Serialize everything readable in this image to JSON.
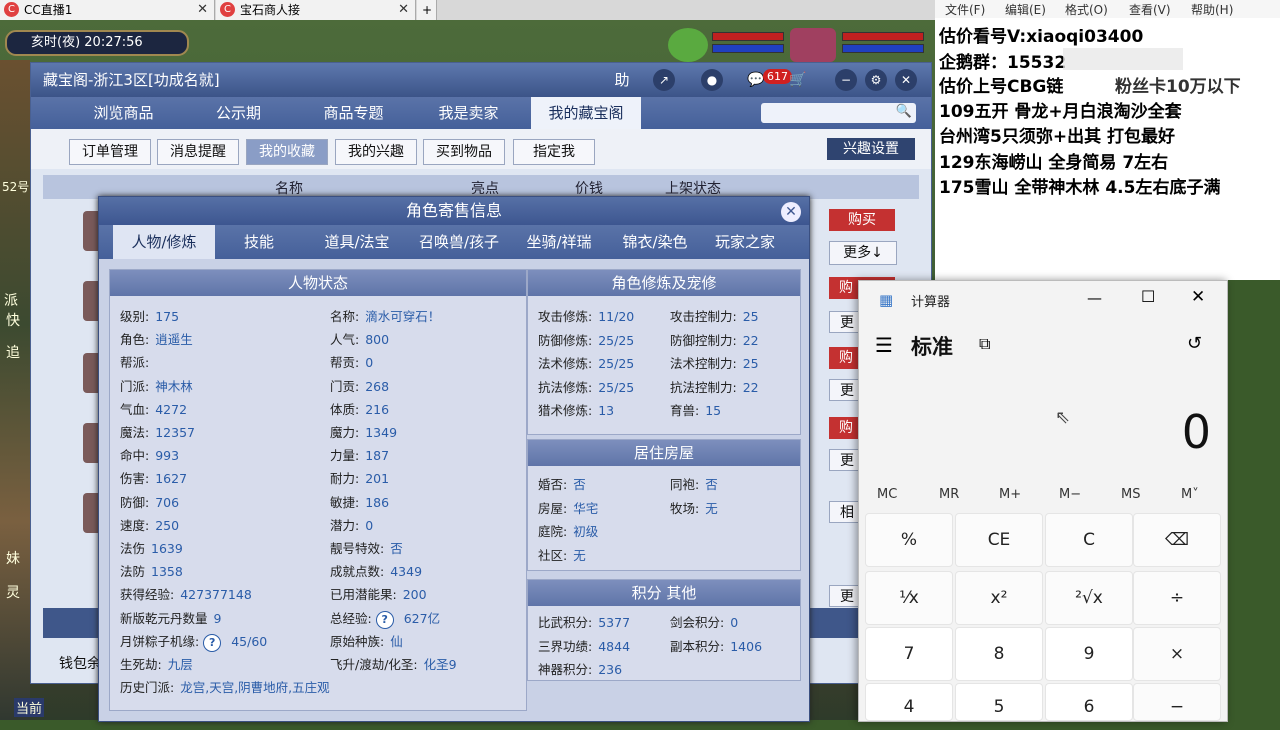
{
  "browser": {
    "tabs": [
      {
        "label": "CC直播1"
      },
      {
        "label": "宝石商人接"
      }
    ],
    "add_tab": "+"
  },
  "game": {
    "time": "亥时(夜)  20:27:56",
    "left_edge_text": [
      "52号",
      "派",
      "快",
      "追",
      "妹",
      "灵",
      "当前"
    ]
  },
  "cbg": {
    "title": "藏宝阁-浙江3区[功成名就]",
    "title_buttons": {
      "help": "助",
      "msg_count": "617"
    },
    "nav": [
      "浏览商品",
      "公示期",
      "商品专题",
      "我是卖家",
      "我的藏宝阁"
    ],
    "subnav": [
      "订单管理",
      "消息提醒",
      "我的收藏",
      "我的兴趣",
      "买到物品",
      "指定我"
    ],
    "interest_button": "兴趣设置",
    "list_header": [
      "名称",
      "亮点",
      "价钱",
      "上架状态"
    ],
    "row_buttons": {
      "buy": "购买",
      "more": "更多↓",
      "buy_partial": "购",
      "more_partial": "更",
      "rel_partial": "相"
    },
    "wallet_label": "钱包余"
  },
  "dialog": {
    "title": "角色寄售信息",
    "tabs": [
      "人物/修炼",
      "技能",
      "道具/法宝",
      "召唤兽/孩子",
      "坐骑/祥瑞",
      "锦衣/染色",
      "玩家之家"
    ],
    "status": {
      "header": "人物状态",
      "left": [
        [
          "级别:",
          "175"
        ],
        [
          "角色:",
          "逍遥生"
        ],
        [
          "帮派:",
          ""
        ],
        [
          "门派:",
          "神木林"
        ],
        [
          "气血:",
          "4272"
        ],
        [
          "魔法:",
          "12357"
        ],
        [
          "命中:",
          "993"
        ],
        [
          "伤害:",
          "1627"
        ],
        [
          "防御:",
          "706"
        ],
        [
          "速度:",
          "250"
        ],
        [
          "法伤",
          "1639"
        ],
        [
          "法防",
          "1358"
        ],
        [
          "获得经验:",
          "427377148"
        ],
        [
          "新版乾元丹数量",
          "9"
        ],
        [
          "月饼粽子机缘:",
          "45/60"
        ],
        [
          "生死劫:",
          "九层"
        ],
        [
          "历史门派:",
          "龙宫,天宫,阴曹地府,五庄观"
        ]
      ],
      "right": [
        [
          "名称:",
          "滴水可穿石！"
        ],
        [
          "人气:",
          "800"
        ],
        [
          "帮贡:",
          "0"
        ],
        [
          "门贡:",
          "268"
        ],
        [
          "体质:",
          "216"
        ],
        [
          "魔力:",
          "1349"
        ],
        [
          "力量:",
          "187"
        ],
        [
          "耐力:",
          "201"
        ],
        [
          "敏捷:",
          "186"
        ],
        [
          "潜力:",
          "0"
        ],
        [
          "靓号特效:",
          "否"
        ],
        [
          "成就点数:",
          "4349"
        ],
        [
          "已用潜能果:",
          "200"
        ],
        [
          "总经验:",
          "627亿"
        ],
        [
          "原始种族:",
          "仙"
        ],
        [
          "飞升/渡劫/化圣:",
          "化圣9"
        ]
      ]
    },
    "cultivation": {
      "header": "角色修炼及宠修",
      "rows": [
        [
          "攻击修炼:",
          "11/20",
          "攻击控制力:",
          "25"
        ],
        [
          "防御修炼:",
          "25/25",
          "防御控制力:",
          "22"
        ],
        [
          "法术修炼:",
          "25/25",
          "法术控制力:",
          "25"
        ],
        [
          "抗法修炼:",
          "25/25",
          "抗法控制力:",
          "22"
        ],
        [
          "猎术修炼:",
          "13",
          "育兽:",
          "15"
        ]
      ]
    },
    "house": {
      "header": "居住房屋",
      "rows": [
        [
          "婚否:",
          "否",
          "同袍:",
          "否"
        ],
        [
          "房屋:",
          "华宅",
          "牧场:",
          "无"
        ],
        [
          "庭院:",
          "初级",
          "",
          ""
        ],
        [
          "社区:",
          "无",
          "",
          ""
        ]
      ]
    },
    "points": {
      "header": "积分 其他",
      "rows": [
        [
          "比武积分:",
          "5377",
          "剑会积分:",
          "0"
        ],
        [
          "三界功绩:",
          "4844",
          "副本积分:",
          "1406"
        ],
        [
          "神器积分:",
          "236",
          "",
          ""
        ]
      ]
    }
  },
  "notepad": {
    "menu": [
      "文件(F)",
      "编辑(E)",
      "格式(O)",
      "查看(V)",
      "帮助(H)"
    ],
    "lines": [
      "估价看号V:xiaoqi03400",
      "企鹅群：15532",
      "估价上号CBG链",
      "109五开 骨龙+月白浪淘沙全套",
      "台州湾5只须弥+出其 打包最好",
      "129东海崂山 全身简易  7左右",
      "175雪山 全带神木林  4.5左右底子满"
    ],
    "obscured_tail": "粉丝卡10万以下"
  },
  "calculator": {
    "title": "计算器",
    "mode": "标准",
    "display": "0",
    "memory": [
      "MC",
      "MR",
      "M+",
      "M−",
      "MS",
      "M˅"
    ],
    "keys": [
      [
        "%",
        "CE",
        "C",
        "⌫"
      ],
      [
        "¹⁄x",
        "x²",
        "²√x",
        "÷"
      ],
      [
        "7",
        "8",
        "9",
        "×"
      ],
      [
        "4",
        "5",
        "6",
        "−"
      ]
    ]
  }
}
